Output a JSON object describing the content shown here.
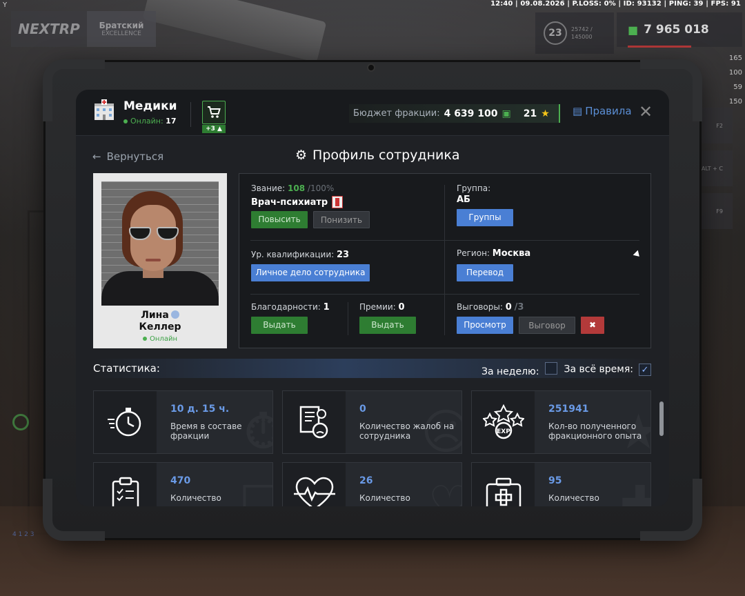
{
  "hud": {
    "corner_letter": "Y",
    "status_line": "12:40 | 09.08.2026 | P.LOSS: 0% | ID: 93132 | PING: 39 | FPS: 91",
    "logo_text": "NEXTRP",
    "server_name": "Братский",
    "server_sub": "EXCELLENCE",
    "level": "23",
    "exp_current": "25742 /",
    "exp_total": "145000",
    "money": "7 965 018",
    "stat_values": [
      "165",
      "100",
      "59",
      "150"
    ],
    "side_keys": [
      "F2",
      "ALT + C",
      "F9"
    ],
    "bottom_nums": "4   1   2   3"
  },
  "faction": {
    "name": "Медики",
    "online_label": "Онлайн:",
    "online_count": "17",
    "shop_badge": "+3",
    "budget_label": "Бюджет фракции:",
    "budget_value": "4 639 100",
    "rating": "21",
    "rules_label": "Правила"
  },
  "nav": {
    "back_label": "Вернуться",
    "title": "Профиль сотрудника"
  },
  "employee": {
    "first_name": "Лина",
    "last_name": "Келлер",
    "status": "Онлайн"
  },
  "profile": {
    "rank_label": "Звание:",
    "rank_current": "108",
    "rank_max": "/100%",
    "rank_title": "Врач-психиатр",
    "promote_label": "Повысить",
    "demote_label": "Понизить",
    "group_label": "Группа:",
    "group_value": "АБ",
    "groups_button": "Группы",
    "qual_label": "Ур. квалификации:",
    "qual_value": "23",
    "file_button": "Личное дело сотрудника",
    "region_label": "Регион:",
    "region_value": "Москва",
    "transfer_button": "Перевод",
    "thanks_label": "Благодарности:",
    "thanks_value": "1",
    "thanks_button": "Выдать",
    "bonus_label": "Премии:",
    "bonus_value": "0",
    "bonus_button": "Выдать",
    "reprimand_label": "Выговоры:",
    "reprimand_value": "0",
    "reprimand_max": "/3",
    "view_button": "Просмотр",
    "reprimand_button": "Выговор"
  },
  "stats": {
    "heading": "Статистика:",
    "filter_week": "За неделю:",
    "filter_all": "За всё время:",
    "filter_week_checked": false,
    "filter_all_checked": true,
    "items": [
      {
        "value": "10 д. 15 ч.",
        "desc": "Время в составе фракции",
        "icon": "stopwatch-icon"
      },
      {
        "value": "0",
        "desc": "Количество жалоб на сотрудника",
        "icon": "complaint-icon"
      },
      {
        "value": "251941",
        "desc": "Кол-во полученного фракционного опыта",
        "icon": "exp-icon"
      },
      {
        "value": "470",
        "desc": "Количество",
        "icon": "clipboard-icon"
      },
      {
        "value": "26",
        "desc": "Количество",
        "icon": "heartbeat-icon"
      },
      {
        "value": "95",
        "desc": "Количество",
        "icon": "medkit-icon"
      }
    ]
  },
  "colors": {
    "accent_green": "#4caf50",
    "accent_blue": "#4a7fd4",
    "danger_red": "#b33a3a",
    "value_blue": "#6a9ae6"
  }
}
